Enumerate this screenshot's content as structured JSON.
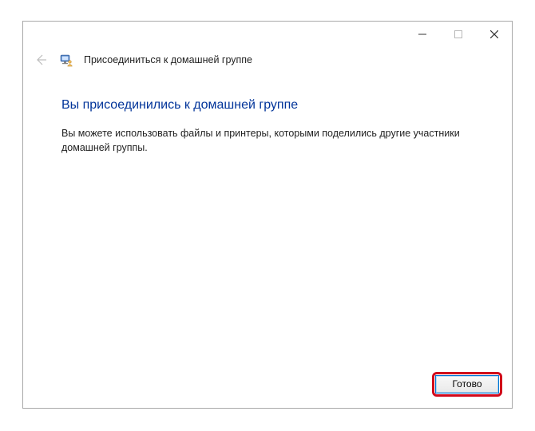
{
  "window": {
    "title": "Присоединиться к домашней группе"
  },
  "content": {
    "heading": "Вы присоединились к домашней группе",
    "body": "Вы можете использовать файлы и принтеры, которыми поделились другие участники домашней группы."
  },
  "footer": {
    "done_label": "Готово"
  }
}
